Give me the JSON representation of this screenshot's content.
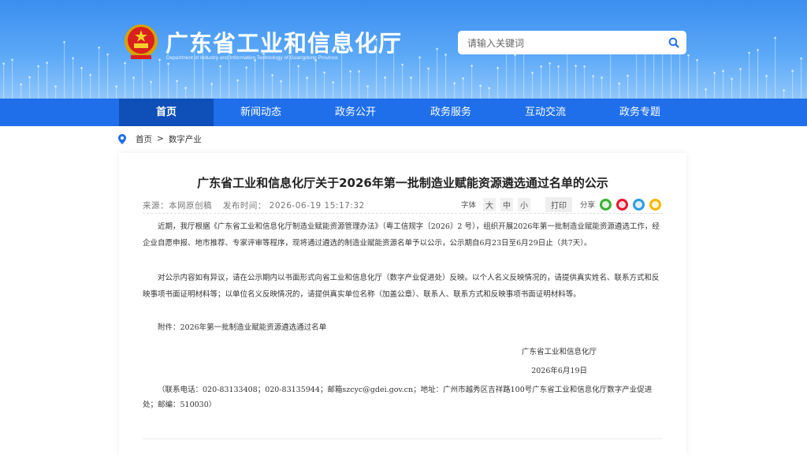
{
  "header": {
    "site_title": "广东省工业和信息化厅",
    "site_subtitle": "Department of Industry and Information Technology of Guangdong Province",
    "search_placeholder": "请输入关键词"
  },
  "nav": {
    "items": [
      {
        "label": "首页",
        "active": true
      },
      {
        "label": "新闻动态",
        "active": false
      },
      {
        "label": "政务公开",
        "active": false
      },
      {
        "label": "政务服务",
        "active": false
      },
      {
        "label": "互动交流",
        "active": false
      },
      {
        "label": "政务专题",
        "active": false
      }
    ]
  },
  "breadcrumb": {
    "home": "首页",
    "separator": ">",
    "current": "数字产业"
  },
  "article": {
    "title": "广东省工业和信息化厅关于2026年第一批制造业赋能资源遴选通过名单的公示",
    "source": "来源：本网原创稿",
    "publish_time": "发布时间： 2026-06-19 15:17:32",
    "font_label": "字体",
    "font_sizes": [
      "大",
      "中",
      "小"
    ],
    "print_label": "打印",
    "share_label": "分享",
    "share_icons": [
      "wechat-icon",
      "weibo-icon",
      "qq-icon",
      "favorite-icon"
    ],
    "paragraphs": [
      "近期，我厅根据《广东省工业和信息化厅制造业赋能资源管理办法》（粤工信规字〔2026〕2 号），组织开展2026年第一批制造业赋能资源遴选工作，经企业自愿申报、地市推荐、专家评审等程序，现将通过遴选的制造业赋能资源名单予以公示，公示期自6月23日至6月29日止（共7天）。",
      "对公示内容如有异议，请在公示期内以书面形式向省工业和信息化厅（数字产业促进处）反映。以个人名义反映情况的，请提供真实姓名、联系方式和反映事项书面证明材料等；以单位名义反映情况的，请提供真实单位名称（加盖公章）、联系人、联系方式和反映事项书面证明材料等。",
      "附件：2026年第一批制造业赋能资源遴选通过名单"
    ],
    "signature": "广东省工业和信息化厅",
    "date": "2026年6月19日",
    "contact": "（联系电话：020-83133408；020-83135944；邮箱szcyc@gdei.gov.cn；地址：广州市越秀区吉祥路100号广东省工业和信息化厅数字产业促进处；邮编：510030）"
  },
  "colors": {
    "nav_bg": "#1f6fea",
    "nav_active": "#0e4fb8",
    "banner": "#4a9cf5"
  }
}
